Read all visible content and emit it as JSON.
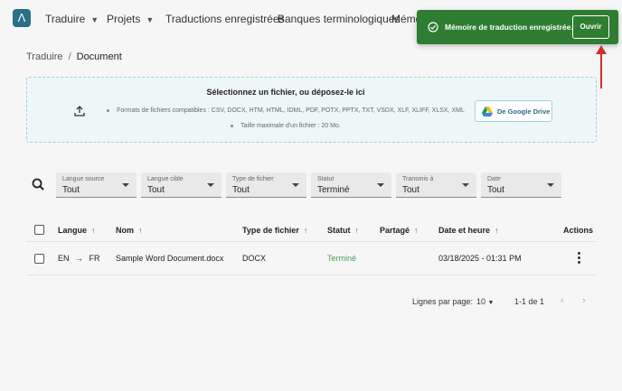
{
  "nav": {
    "logo": "Λ",
    "items": [
      {
        "label": "Traduire",
        "dropdown": true
      },
      {
        "label": "Projets",
        "dropdown": true
      },
      {
        "label": "Traductions enregistrées",
        "dropdown": false
      },
      {
        "label": "Banques terminologiques",
        "dropdown": false
      },
      {
        "label": "Mémo",
        "dropdown": false
      }
    ]
  },
  "breadcrumb": {
    "root": "Traduire",
    "separator": "/",
    "current": "Document"
  },
  "upload": {
    "title": "Sélectionnez un fichier, ou déposez-le ici",
    "formats": "Formats de fichiers compatibles : CSV, DOCX, HTM, HTML, IDML, PDF, POTX, PPTX, TXT, VSDX, XLF, XLIFF, XLSX, XML",
    "max_size": "Taille maximale d'un fichier : 20 Mo.",
    "gdrive_label": "De Google Drive"
  },
  "filters": [
    {
      "label": "Langue source",
      "value": "Tout"
    },
    {
      "label": "Langue cible",
      "value": "Tout"
    },
    {
      "label": "Type de fichier",
      "value": "Tout"
    },
    {
      "label": "Statut",
      "value": "Terminé"
    },
    {
      "label": "Transmis à",
      "value": "Tout"
    },
    {
      "label": "Date",
      "value": "Tout"
    }
  ],
  "table": {
    "headers": {
      "language": "Langue",
      "name": "Nom",
      "file_type": "Type de fichier",
      "status": "Statut",
      "shared": "Partagé",
      "datetime": "Date et heure",
      "actions": "Actions"
    },
    "sort_arrow": "↑",
    "rows": [
      {
        "source_lang": "EN",
        "arrow": "→",
        "target_lang": "FR",
        "name": "Sample Word Document.docx",
        "file_type": "DOCX",
        "status": "Terminé",
        "shared": "",
        "datetime": "03/18/2025 - 01:31 PM"
      }
    ]
  },
  "pagination": {
    "rows_per_page_label": "Lignes par page:",
    "rows_per_page": "10",
    "range": "1-1 de 1",
    "prev": "‹",
    "next": "›"
  },
  "toast": {
    "message": "Mémoire de traduction enregistrée.",
    "button": "Ouvrir",
    "color": "#2e7d32"
  },
  "colors": {
    "accent": "#2b6f8a",
    "success": "#4aa05a",
    "annotation": "#d32f2f"
  }
}
